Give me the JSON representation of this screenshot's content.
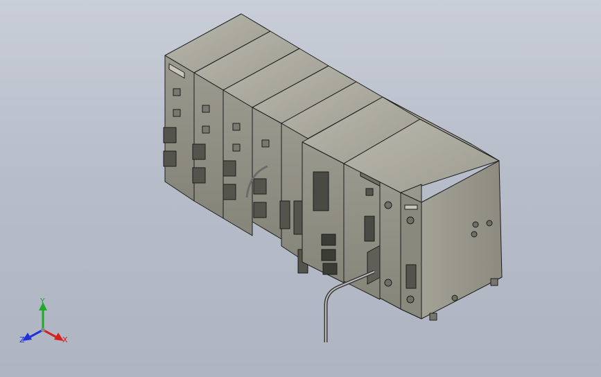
{
  "viewport": {
    "background_top": "#c9ced8",
    "background_bottom": "#aeb4c1",
    "model": {
      "part_color": "#8f8e83",
      "part_top_color": "#a8a79b",
      "part_dark_color": "#6f6e64",
      "edge_color": "#1c1c1c"
    }
  },
  "triad": {
    "x_label": "X",
    "y_label": "Y",
    "z_label": "Z",
    "x_color": "#d62020",
    "y_color": "#1faa2a",
    "z_color": "#2130d8"
  }
}
